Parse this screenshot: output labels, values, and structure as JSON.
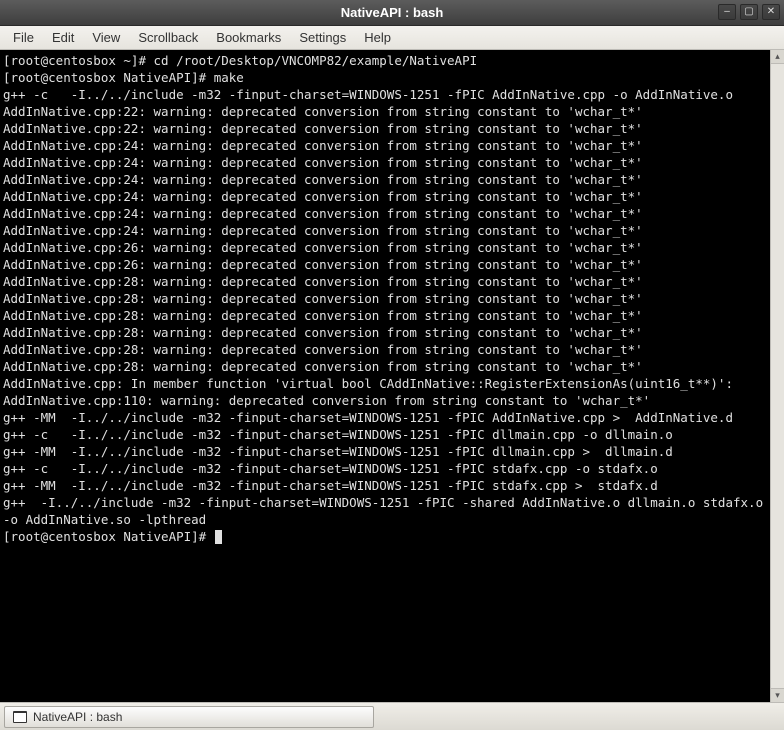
{
  "window": {
    "title": "NativeAPI : bash"
  },
  "menubar": {
    "items": [
      "File",
      "Edit",
      "View",
      "Scrollback",
      "Bookmarks",
      "Settings",
      "Help"
    ]
  },
  "terminal": {
    "prompt1_user": "[root@centosbox ~]# ",
    "prompt1_cmd": "cd /root/Desktop/VNCOMP82/example/NativeAPI",
    "prompt2_user": "[root@centosbox NativeAPI]# ",
    "prompt2_cmd": "make",
    "lines": [
      "g++ -c   -I../../include -m32 -finput-charset=WINDOWS-1251 -fPIC AddInNative.cpp -o AddInNative.o",
      "AddInNative.cpp:22: warning: deprecated conversion from string constant to 'wchar_t*'",
      "AddInNative.cpp:22: warning: deprecated conversion from string constant to 'wchar_t*'",
      "AddInNative.cpp:24: warning: deprecated conversion from string constant to 'wchar_t*'",
      "AddInNative.cpp:24: warning: deprecated conversion from string constant to 'wchar_t*'",
      "AddInNative.cpp:24: warning: deprecated conversion from string constant to 'wchar_t*'",
      "AddInNative.cpp:24: warning: deprecated conversion from string constant to 'wchar_t*'",
      "AddInNative.cpp:24: warning: deprecated conversion from string constant to 'wchar_t*'",
      "AddInNative.cpp:24: warning: deprecated conversion from string constant to 'wchar_t*'",
      "AddInNative.cpp:26: warning: deprecated conversion from string constant to 'wchar_t*'",
      "AddInNative.cpp:26: warning: deprecated conversion from string constant to 'wchar_t*'",
      "AddInNative.cpp:28: warning: deprecated conversion from string constant to 'wchar_t*'",
      "AddInNative.cpp:28: warning: deprecated conversion from string constant to 'wchar_t*'",
      "AddInNative.cpp:28: warning: deprecated conversion from string constant to 'wchar_t*'",
      "AddInNative.cpp:28: warning: deprecated conversion from string constant to 'wchar_t*'",
      "AddInNative.cpp:28: warning: deprecated conversion from string constant to 'wchar_t*'",
      "AddInNative.cpp:28: warning: deprecated conversion from string constant to 'wchar_t*'",
      "AddInNative.cpp: In member function 'virtual bool CAddInNative::RegisterExtensionAs(uint16_t**)':",
      "AddInNative.cpp:110: warning: deprecated conversion from string constant to 'wchar_t*'",
      "g++ -MM  -I../../include -m32 -finput-charset=WINDOWS-1251 -fPIC AddInNative.cpp >  AddInNative.d",
      "g++ -c   -I../../include -m32 -finput-charset=WINDOWS-1251 -fPIC dllmain.cpp -o dllmain.o",
      "g++ -MM  -I../../include -m32 -finput-charset=WINDOWS-1251 -fPIC dllmain.cpp >  dllmain.d",
      "g++ -c   -I../../include -m32 -finput-charset=WINDOWS-1251 -fPIC stdafx.cpp -o stdafx.o",
      "g++ -MM  -I../../include -m32 -finput-charset=WINDOWS-1251 -fPIC stdafx.cpp >  stdafx.d",
      "g++  -I../../include -m32 -finput-charset=WINDOWS-1251 -fPIC -shared AddInNative.o dllmain.o stdafx.o -o AddInNative.so -lpthread"
    ],
    "prompt3_user": "[root@centosbox NativeAPI]# "
  },
  "taskbar": {
    "button_label": "NativeAPI : bash"
  }
}
